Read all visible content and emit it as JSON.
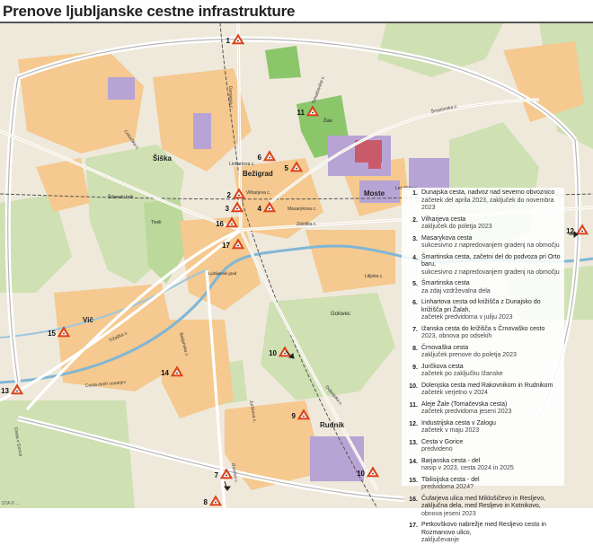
{
  "title": "Prenove ljubljanske cestne infrastrukture",
  "credit": "STA  © ...",
  "areas": [
    {
      "name": "Šiška"
    },
    {
      "name": "Bežigrad"
    },
    {
      "name": "Moste"
    },
    {
      "name": "Golovec"
    },
    {
      "name": "Vič"
    },
    {
      "name": "Rudnik"
    },
    {
      "name": "Šišenski hrib"
    },
    {
      "name": "Tivoli"
    },
    {
      "name": "Žale"
    },
    {
      "name": "Ljubljanski grad"
    }
  ],
  "streets": [
    {
      "name": "Dunajska c."
    },
    {
      "name": "Vilharjeva c."
    },
    {
      "name": "Šmartinska c."
    },
    {
      "name": "Celovška c."
    },
    {
      "name": "Tržaška c."
    },
    {
      "name": "Dolenjska c."
    },
    {
      "name": "Ižanska c."
    },
    {
      "name": "Barjanska c."
    },
    {
      "name": "Cesta v Gorice"
    },
    {
      "name": "Jurčkova c."
    },
    {
      "name": "Linhartova c."
    },
    {
      "name": "Zaloška c."
    },
    {
      "name": "Masarykova c."
    },
    {
      "name": "Cesta dveh cesarjev"
    },
    {
      "name": "Litijska c."
    },
    {
      "name": "Tomačevska c."
    },
    {
      "name": "Letališka c."
    }
  ],
  "markers": [
    {
      "n": "1"
    },
    {
      "n": "2"
    },
    {
      "n": "3"
    },
    {
      "n": "4"
    },
    {
      "n": "5"
    },
    {
      "n": "6"
    },
    {
      "n": "7"
    },
    {
      "n": "8"
    },
    {
      "n": "9"
    },
    {
      "n": "10"
    },
    {
      "n": "10"
    },
    {
      "n": "11"
    },
    {
      "n": "12"
    },
    {
      "n": "13"
    },
    {
      "n": "14"
    },
    {
      "n": "15"
    },
    {
      "n": "16"
    },
    {
      "n": "17"
    }
  ],
  "legend": [
    {
      "n": "1.",
      "name": "Dunajska cesta, nadvoz nad severno obvoznico",
      "desc": "začetek del aprila 2023, zaključek do novembra 2023"
    },
    {
      "n": "2.",
      "name": "Vilharjeva cesta",
      "desc": "zaključek do poletja 2023"
    },
    {
      "n": "3.",
      "name": "Masarykova cesta",
      "desc": "sukcesivno z napredovanjem gradenj na območju"
    },
    {
      "n": "4.",
      "name": "Šmartinska cesta, začetni del do podvoza pri Orto baru,",
      "desc": "sukcesivno z napredovanjem gradenj na območju"
    },
    {
      "n": "5.",
      "name": "Šmartinska cesta",
      "desc": "za zdaj vzdrževalna dela"
    },
    {
      "n": "6.",
      "name": "Linhartova cesta od križišča z Dunajsko do križišča pri Žalah,",
      "desc": "začetek predvidoma v juliju 2023"
    },
    {
      "n": "7.",
      "name": "Ižanska cesta do križišča s Črnovaško cesto",
      "desc": "2023, obnova po odsekih"
    },
    {
      "n": "8.",
      "name": "Črnovaška cesta",
      "desc": "zaključek prenove do poletja 2023"
    },
    {
      "n": "9.",
      "name": "Jurčkova cesta",
      "desc": "začetek po zaključku Ižanske"
    },
    {
      "n": "10.",
      "name": "Dolenjska cesta med Rakovnikom in Rudnikom",
      "desc": "začetek verjetno v 2024"
    },
    {
      "n": "11.",
      "name": "Aleje Žale (Tomačevska cesta)",
      "desc": "začetek predvidoma jeseni 2023"
    },
    {
      "n": "12.",
      "name": "Industrijska cesta v Zalogu",
      "desc": "začetek v maju 2023"
    },
    {
      "n": "13.",
      "name": "Cesta v Gorice",
      "desc": "predvideno"
    },
    {
      "n": "14.",
      "name": "Barjanska cesta - del",
      "desc": "nasip v 2023, cesta 2024 in 2025"
    },
    {
      "n": "15.",
      "name": "Tbilisijska cesta - del",
      "desc": "predvidoma 2024?"
    },
    {
      "n": "16.",
      "name": "Čufarjeva ulica med Miklošičevo in Resljevo, zaključna dela, med Resljevo in Kotnikovo,",
      "desc": "obnova jeseni 2023"
    },
    {
      "n": "17.",
      "name": "Petkovškovo nabrežje med Resljevo cesto in Rozmanovo ulico,",
      "desc": "zaključevanje"
    }
  ]
}
